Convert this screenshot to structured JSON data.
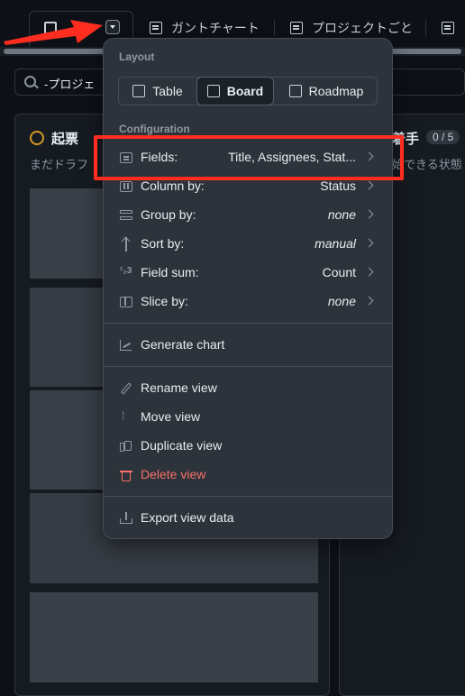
{
  "tabs": [
    {
      "label": "ガントチャート"
    },
    {
      "label": "プロジェクトごと"
    }
  ],
  "filter": {
    "value": "-プロジェ"
  },
  "columns": [
    {
      "title": "起票",
      "description": "まだドラフ"
    },
    {
      "title": "着手",
      "count": "0 / 5",
      "description": "始できる状態"
    }
  ],
  "menu": {
    "layout_label": "Layout",
    "layouts": [
      {
        "label": "Table",
        "active": false
      },
      {
        "label": "Board",
        "active": true
      },
      {
        "label": "Roadmap",
        "active": false
      }
    ],
    "configuration_label": "Configuration",
    "config_rows": [
      {
        "icon": "fields-icon",
        "label": "Fields:",
        "value": "Title, Assignees, Stat..."
      },
      {
        "icon": "columns-icon",
        "label": "Column by:",
        "value": "Status"
      },
      {
        "icon": "group-icon",
        "label": "Group by:",
        "value": "none"
      },
      {
        "icon": "sort-icon",
        "label": "Sort by:",
        "value": "manual"
      },
      {
        "icon": "sum-icon",
        "label": "Field sum:",
        "value": "Count"
      },
      {
        "icon": "slice-icon",
        "label": "Slice by:",
        "value": "none"
      }
    ],
    "generate_chart": "Generate chart",
    "rename_view": "Rename view",
    "move_view": "Move view",
    "duplicate_view": "Duplicate view",
    "delete_view": "Delete view",
    "export_view_data": "Export view data",
    "sum_icon_text": "¹₂3"
  },
  "colors": {
    "highlight": "#ff2d1f",
    "danger": "#f47067",
    "menu_bg": "#2d333b",
    "page_bg": "#0d1117"
  }
}
